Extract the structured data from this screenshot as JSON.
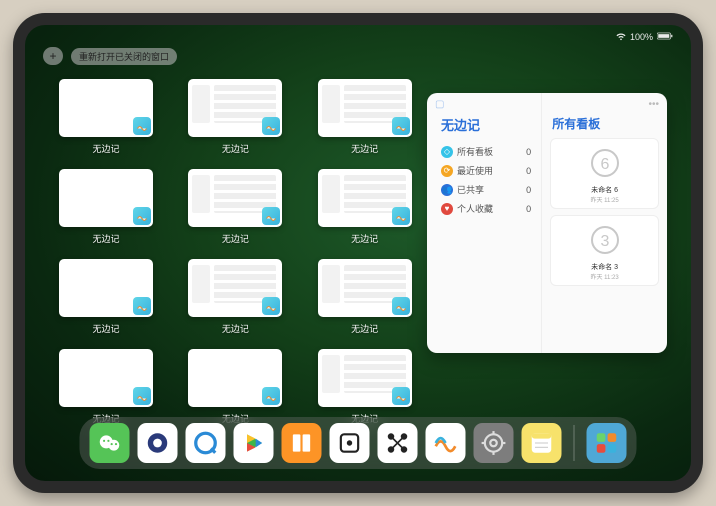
{
  "status": {
    "battery_text": "100%"
  },
  "top": {
    "plus_label": "+",
    "reopen_label": "重新打开已关闭的窗口"
  },
  "overview": {
    "app_label": "无边记",
    "windows": [
      {
        "variant": "blank"
      },
      {
        "variant": "content"
      },
      {
        "variant": "content"
      },
      {
        "variant": "blank"
      },
      {
        "variant": "content"
      },
      {
        "variant": "content"
      },
      {
        "variant": "blank"
      },
      {
        "variant": "content"
      },
      {
        "variant": "content"
      },
      {
        "variant": "blank"
      },
      {
        "variant": "blank"
      },
      {
        "variant": "content"
      }
    ]
  },
  "panel": {
    "left_title": "无边记",
    "right_title": "所有看板",
    "items": [
      {
        "icon_color": "#35c3e8",
        "label": "所有看板",
        "count": 0
      },
      {
        "icon_color": "#f5a623",
        "label": "最近使用",
        "count": 0
      },
      {
        "icon_color": "#2a6fd8",
        "label": "已共享",
        "count": 0
      },
      {
        "icon_color": "#e0493e",
        "label": "个人收藏",
        "count": 0
      }
    ],
    "boards": [
      {
        "name": "未命名 6",
        "sub": "昨天 11:25",
        "digit": "6"
      },
      {
        "name": "未命名 3",
        "sub": "昨天 11:23",
        "digit": "3"
      }
    ]
  },
  "dock": {
    "icons": [
      {
        "name": "wechat-icon",
        "bg": "#55c457"
      },
      {
        "name": "quark-icon",
        "bg": "#ffffff"
      },
      {
        "name": "browser-icon",
        "bg": "#ffffff"
      },
      {
        "name": "play-icon",
        "bg": "#ffffff"
      },
      {
        "name": "books-icon",
        "bg": "#fd9426"
      },
      {
        "name": "dice-icon",
        "bg": "#ffffff"
      },
      {
        "name": "nodes-icon",
        "bg": "#ffffff"
      },
      {
        "name": "freeform-icon",
        "bg": "#ffffff"
      },
      {
        "name": "settings-icon",
        "bg": "#7d7d7d"
      },
      {
        "name": "notes-icon",
        "bg": "#f7e26b"
      },
      {
        "name": "apps-icon",
        "bg": "#4fa8d6"
      }
    ]
  }
}
